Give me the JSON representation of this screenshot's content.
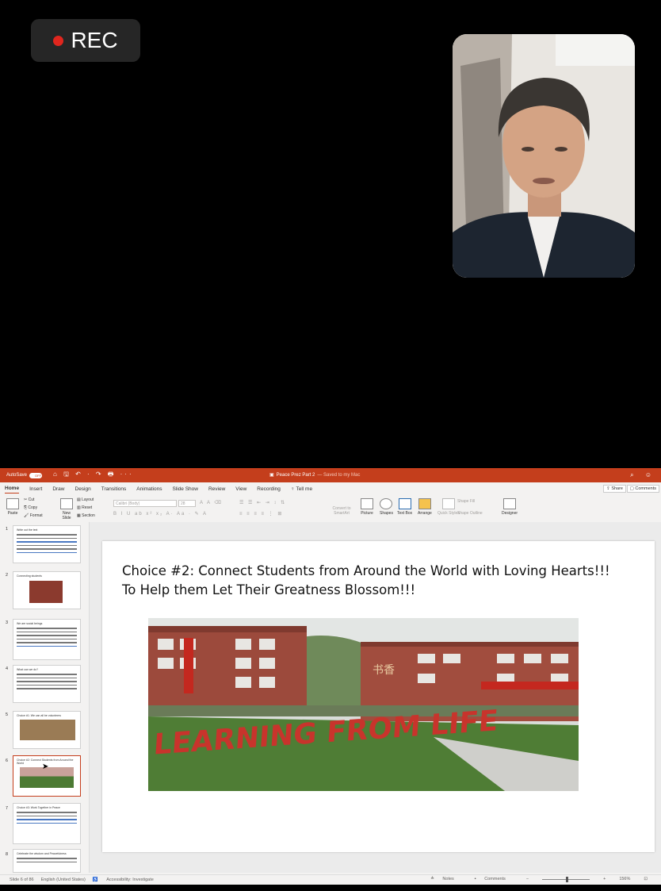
{
  "recording": {
    "label": "REC",
    "dot_color": "#e0261e"
  },
  "powerpoint": {
    "titlebar": {
      "autosave_label": "AutoSave",
      "autosave_state": "OFF",
      "quick_access": "⌂ 🖫 ↶ · ↷ 🖶 ···",
      "doc_title": "Peace Prez Part 2",
      "doc_status": "— Saved to my Mac",
      "accent_color": "#c43e1c"
    },
    "tabs": [
      "Home",
      "Insert",
      "Draw",
      "Design",
      "Transitions",
      "Animations",
      "Slide Show",
      "Review",
      "View",
      "Recording",
      "Tell me"
    ],
    "active_tab": "Home",
    "share_label": "Share",
    "comments_label": "Comments",
    "ribbon": {
      "paste": "Paste",
      "cut": "Cut",
      "copy": "Copy",
      "format": "Format",
      "new_slide": "New Slide",
      "layout": "Layout",
      "reset": "Reset",
      "section": "Section",
      "font_name": "Calibri (Body)",
      "font_size": "28",
      "convert_smartart": "Convert to SmartArt",
      "picture": "Picture",
      "shapes": "Shapes",
      "text_box": "Text Box",
      "arrange": "Arrange",
      "quick_styles": "Quick Styles",
      "shape_fill": "Shape Fill",
      "shape_outline": "Shape Outline",
      "designer": "Designer"
    },
    "thumbnails": [
      {
        "number": "1",
        "caption": "Write out the text"
      },
      {
        "number": "2",
        "caption": "Connecting students"
      },
      {
        "number": "3",
        "caption": "We are social beings"
      },
      {
        "number": "4",
        "caption": "What can we do?"
      },
      {
        "number": "5",
        "caption": "Choice #1: We can all be volunteers"
      },
      {
        "number": "6",
        "caption": "Choice #2: Connect Students from Around the World"
      },
      {
        "number": "7",
        "caption": "Choice #3: Work Together in Peace"
      },
      {
        "number": "8",
        "caption": "Celebrate the wisdom and Peacefulness"
      }
    ],
    "selected_slide": "6",
    "slide": {
      "line1": "Choice #2: Connect Students from Around the World with Loving Hearts!!!",
      "line2": "To Help them Let Their Greatness Blossom!!!",
      "photo_sign_text": "LEARNING FROM LIFE",
      "banner_text": "书香"
    },
    "status_bar": {
      "slide_info": "Slide 6 of 86",
      "language": "English (United States)",
      "accessibility": "Accessibility: Investigate",
      "notes": "Notes",
      "comments": "Comments",
      "zoom": "156%"
    }
  }
}
